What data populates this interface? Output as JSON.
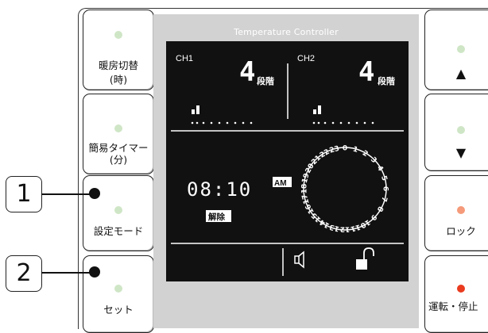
{
  "panel_title": "Temperature Controller",
  "left_buttons": [
    {
      "label_line1": "暖房切替",
      "label_line2": "(時)",
      "led": "green"
    },
    {
      "label_line1": "簡易タイマー",
      "label_line2": "(分)",
      "led": "green"
    },
    {
      "label_line1": "設定モード",
      "label_line2": "",
      "led": "green"
    },
    {
      "label_line1": "セット",
      "label_line2": "",
      "led": "green"
    }
  ],
  "right_buttons": [
    {
      "label": "▲",
      "led": "green"
    },
    {
      "label": "▼",
      "led": "green"
    },
    {
      "label": "ロック",
      "led": "orange"
    },
    {
      "label": "運転・停止",
      "led": "red"
    }
  ],
  "lcd": {
    "ch1_label": "CH1",
    "ch2_label": "CH2",
    "ch1_level": "4",
    "ch2_level": "4",
    "level_suffix": "段階",
    "time": "08:10",
    "ampm": "AM",
    "timer_status": "解除",
    "dial_hours": [
      "0",
      "1",
      "2",
      "3",
      "4",
      "5",
      "6",
      "7",
      "8",
      "9",
      "10",
      "11",
      "12",
      "13",
      "14",
      "15",
      "16",
      "17",
      "18",
      "19",
      "20",
      "21",
      "22",
      "23"
    ]
  },
  "callouts": [
    "1",
    "2"
  ],
  "colors": {
    "led_green": "#cfe6c6",
    "led_orange": "#f59a7a",
    "led_red": "#ea3b1f",
    "lcd_bg": "#111111",
    "center_bg": "#d2d2d2"
  }
}
